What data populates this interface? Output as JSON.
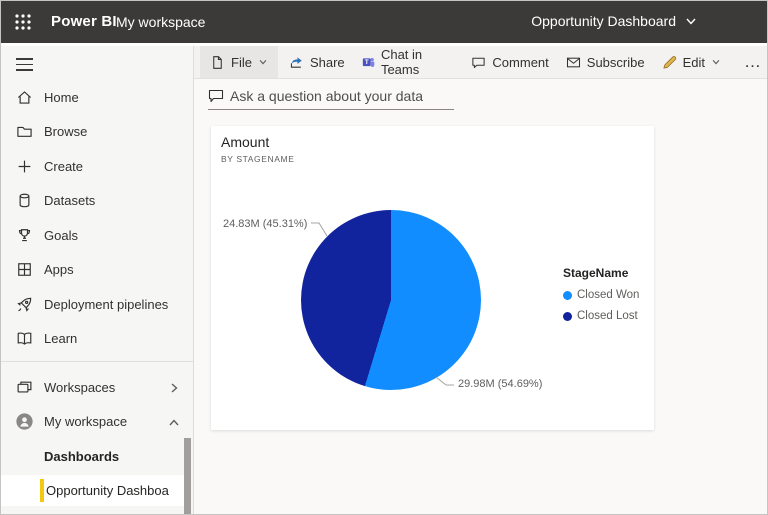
{
  "topbar": {
    "brand": "Power BI",
    "breadcrumb": "My workspace",
    "page_title": "Opportunity Dashboard"
  },
  "toolbar": {
    "file": "File",
    "share": "Share",
    "chat_in_teams": "Chat in Teams",
    "comment": "Comment",
    "subscribe": "Subscribe",
    "edit": "Edit",
    "more": "…"
  },
  "qna": {
    "placeholder": "Ask a question about your data"
  },
  "sidebar": {
    "items": [
      {
        "label": "Home"
      },
      {
        "label": "Browse"
      },
      {
        "label": "Create"
      },
      {
        "label": "Datasets"
      },
      {
        "label": "Goals"
      },
      {
        "label": "Apps"
      },
      {
        "label": "Deployment pipelines"
      },
      {
        "label": "Learn"
      }
    ],
    "workspaces_label": "Workspaces",
    "my_workspace_label": "My workspace",
    "dashboards_header": "Dashboards",
    "selected_item": "Opportunity Dashboa"
  },
  "card": {
    "title": "Amount",
    "subtitle": "BY STAGENAME"
  },
  "chart_data": {
    "type": "pie",
    "title": "Amount",
    "subtitle": "BY STAGENAME",
    "legend_title": "StageName",
    "legend_position": "right",
    "slices": [
      {
        "label": "Closed Won",
        "value": 29.98,
        "unit": "M",
        "percent": 54.69,
        "color": "#118DFF",
        "data_label": "29.98M (54.69%)"
      },
      {
        "label": "Closed Lost",
        "value": 24.83,
        "unit": "M",
        "percent": 45.31,
        "color": "#12239E",
        "data_label": "24.83M (45.31%)"
      }
    ]
  },
  "colors": {
    "selection_accent": "#F2C811",
    "won_blue": "#118DFF",
    "lost_navy": "#12239E"
  }
}
